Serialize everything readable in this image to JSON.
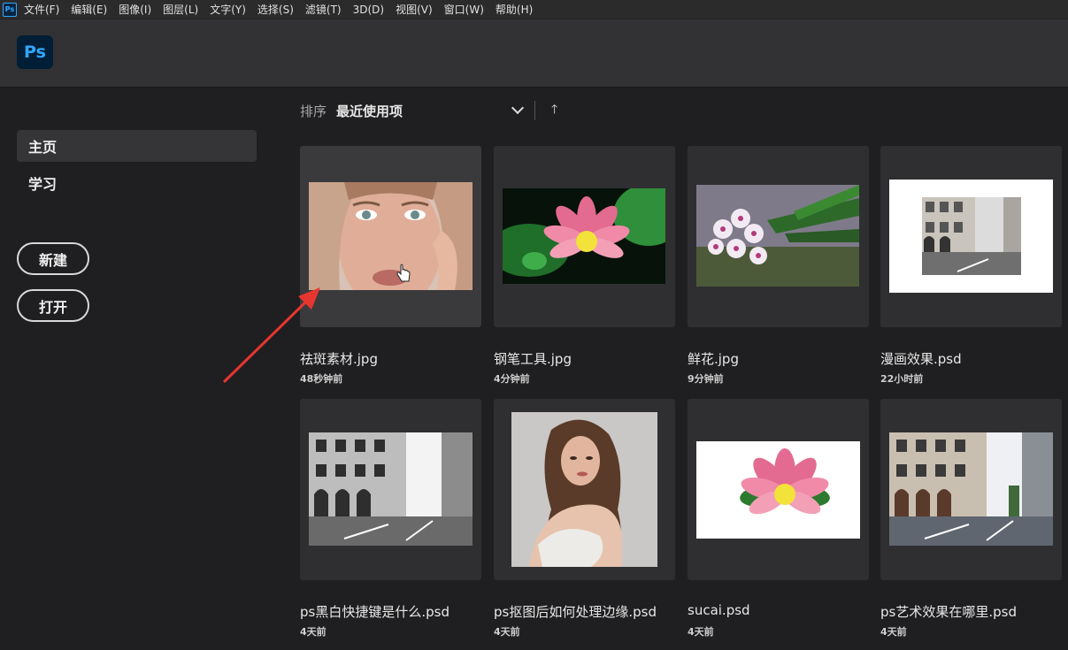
{
  "menu": {
    "app_icon": "Ps",
    "items": [
      "文件(F)",
      "编辑(E)",
      "图像(I)",
      "图层(L)",
      "文字(Y)",
      "选择(S)",
      "滤镜(T)",
      "3D(D)",
      "视图(V)",
      "窗口(W)",
      "帮助(H)"
    ]
  },
  "header": {
    "logo": "Ps"
  },
  "sidebar": {
    "home_label": "主页",
    "learn_label": "学习",
    "new_label": "新建",
    "open_label": "打开"
  },
  "sort": {
    "label": "排序",
    "value": "最近使用项",
    "dropdown_icon": "chevron-down-icon",
    "order_icon": "arrow-up-icon"
  },
  "files": [
    {
      "name": "祛斑素材.jpg",
      "time": "48秒钟前"
    },
    {
      "name": "钢笔工具.jpg",
      "time": "4分钟前"
    },
    {
      "name": "鲜花.jpg",
      "time": "9分钟前"
    },
    {
      "name": "漫画效果.psd",
      "time": "22小时前"
    },
    {
      "name": "ps黑白快捷键是什么.psd",
      "time": "4天前"
    },
    {
      "name": "ps抠图后如何处理边缘.psd",
      "time": "4天前"
    },
    {
      "name": "sucai.psd",
      "time": "4天前"
    },
    {
      "name": "ps艺术效果在哪里.psd",
      "time": "4天前"
    }
  ],
  "colors": {
    "accent": "#31a8ff",
    "annotation_arrow": "#e8352f",
    "background": "#1f1e20"
  }
}
